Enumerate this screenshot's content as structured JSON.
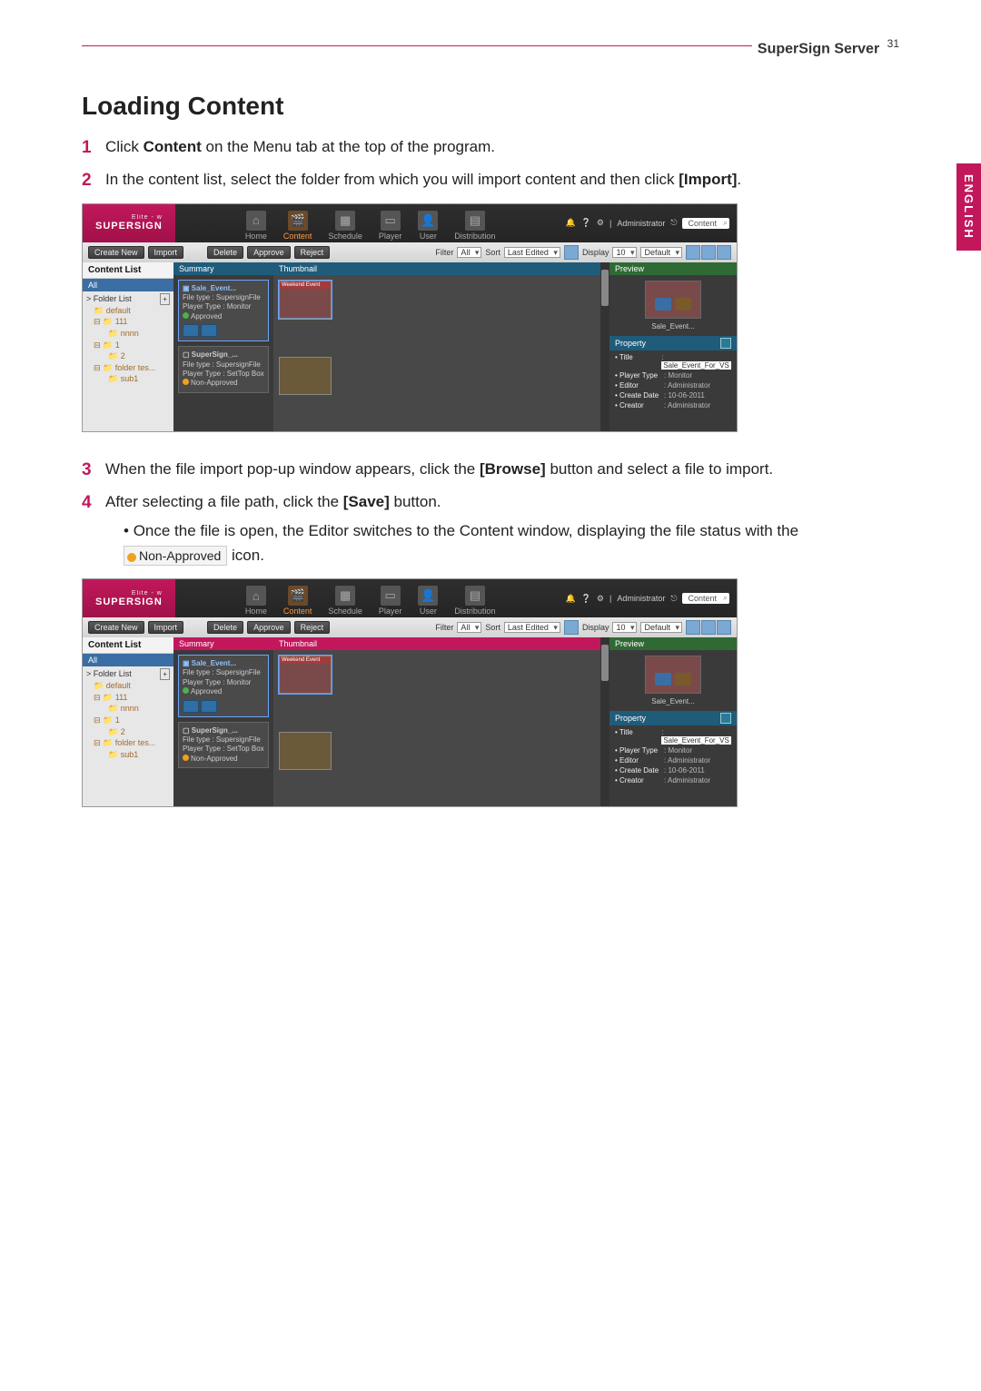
{
  "header": {
    "section_label": "SuperSign Server",
    "page_number": "31"
  },
  "side_tab": "ENGLISH",
  "title": "Loading Content",
  "steps": {
    "s1_pre": "Click ",
    "s1_b": "Content",
    "s1_post": " on the Menu tab at the top of the program.",
    "s2_pre": "In the content list, select the folder from which you will import content and then click ",
    "s2_b": "[Import]",
    "s2_post": ".",
    "s3_pre": "When the file import pop-up window appears, click the ",
    "s3_b": "[Browse]",
    "s3_post": " button and select a file to import.",
    "s4_pre": "After selecting a file path, click the ",
    "s4_b": "[Save]",
    "s4_post": " button.",
    "s4_sub_pre": "Once the file is open, the Editor switches to the Content window, displaying the file status with the ",
    "s4_sub_badge": "Non-Approved",
    "s4_sub_post": " icon."
  },
  "app": {
    "logo": "SUPERSIGN",
    "logo_sub": "Elite - w",
    "tabs": {
      "home": "Home",
      "content": "Content",
      "schedule": "Schedule",
      "player": "Player",
      "user": "User",
      "distribution": "Distribution"
    },
    "account_label": "Administrator",
    "search_placeholder": "Content",
    "toolbar": {
      "create_new": "Create New",
      "import": "Import",
      "delete": "Delete",
      "approve": "Approve",
      "reject": "Reject",
      "filter_label": "Filter",
      "filter_value": "All",
      "sort_label": "Sort",
      "sort_value": "Last Edited",
      "display_label": "Display",
      "display_value": "10",
      "default_value": "Default"
    },
    "content_list": {
      "heading": "Content List",
      "all": "All",
      "folder_list": "> Folder List",
      "default": "default",
      "n111": "111",
      "nnnn": "nnnn",
      "n1": "1",
      "n2": "2",
      "folder_tes": "folder tes...",
      "sub1": "sub1"
    },
    "panels": {
      "summary": "Summary",
      "thumbnail": "Thumbnail",
      "preview": "Preview",
      "property": "Property"
    },
    "cards": {
      "sale_title": "Sale_Event...",
      "sale_filetype": "File type : SupersignFile",
      "sale_playertype": "Player Type : Monitor",
      "approved": "Approved",
      "ss_title": "SuperSign_...",
      "ss_filetype": "File type : SupersignFile",
      "ss_playertype": "Player Type : SetTop Box",
      "non_approved": "Non-Approved",
      "thumb1_label": "Weekend Event"
    },
    "preview_name": "Sale_Event...",
    "property": {
      "title_k": "Title",
      "title_v": "Sale_Event_For_VS",
      "ptype_k": "Player Type",
      "ptype_v": "Monitor",
      "editor_k": "Editor",
      "editor_v": "Administrator",
      "cdate_k": "Create Date",
      "cdate_v": "10-06-2011",
      "creator_k": "Creator",
      "creator_v": "Administrator"
    }
  }
}
